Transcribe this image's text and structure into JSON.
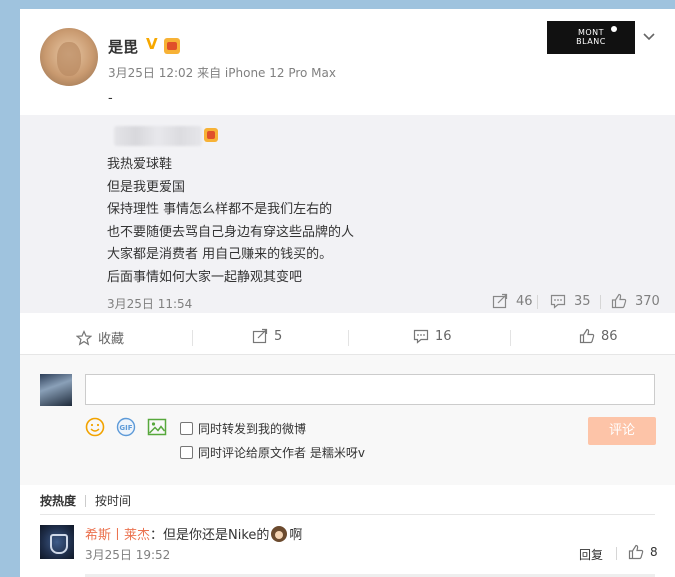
{
  "post": {
    "username": "是毘",
    "verified_badge": "V",
    "meta": "3月25日 12:02 来自 iPhone 12 Pro Max",
    "text": "-",
    "ad_logo": {
      "line1": "MONT",
      "line2": "BLANC"
    }
  },
  "repost": {
    "lines": [
      "我热爱球鞋",
      "但是我更爱国",
      "保持理性 事情怎么样都不是我们左右的",
      "也不要随便去骂自己身边有穿这些品牌的人",
      "大家都是消费者 用自己赚来的钱买的。",
      "后面事情如何大家一起静观其变吧"
    ],
    "date": "3月25日 11:54",
    "forward_count": "46",
    "comment_count": "35",
    "like_count": "370"
  },
  "actions": {
    "favorite": "收藏",
    "forward": "5",
    "comment": "16",
    "like": "86"
  },
  "composer": {
    "placeholder": "",
    "checkbox1": "同时转发到我的微博",
    "checkbox2": "同时评论给原文作者 是糯米呀v",
    "submit": "评论"
  },
  "sort": {
    "hot": "按热度",
    "time": "按时间"
  },
  "comment": {
    "user": "希斯丨莱杰",
    "text_before": "：但是你还是Nike的",
    "text_after": "啊",
    "date": "3月25日 19:52",
    "reply": "回复",
    "likes": "8"
  },
  "colors": {
    "accent": "#eb7350",
    "submit_disabled": "#fdc4a8",
    "badge": "#f7a800"
  }
}
